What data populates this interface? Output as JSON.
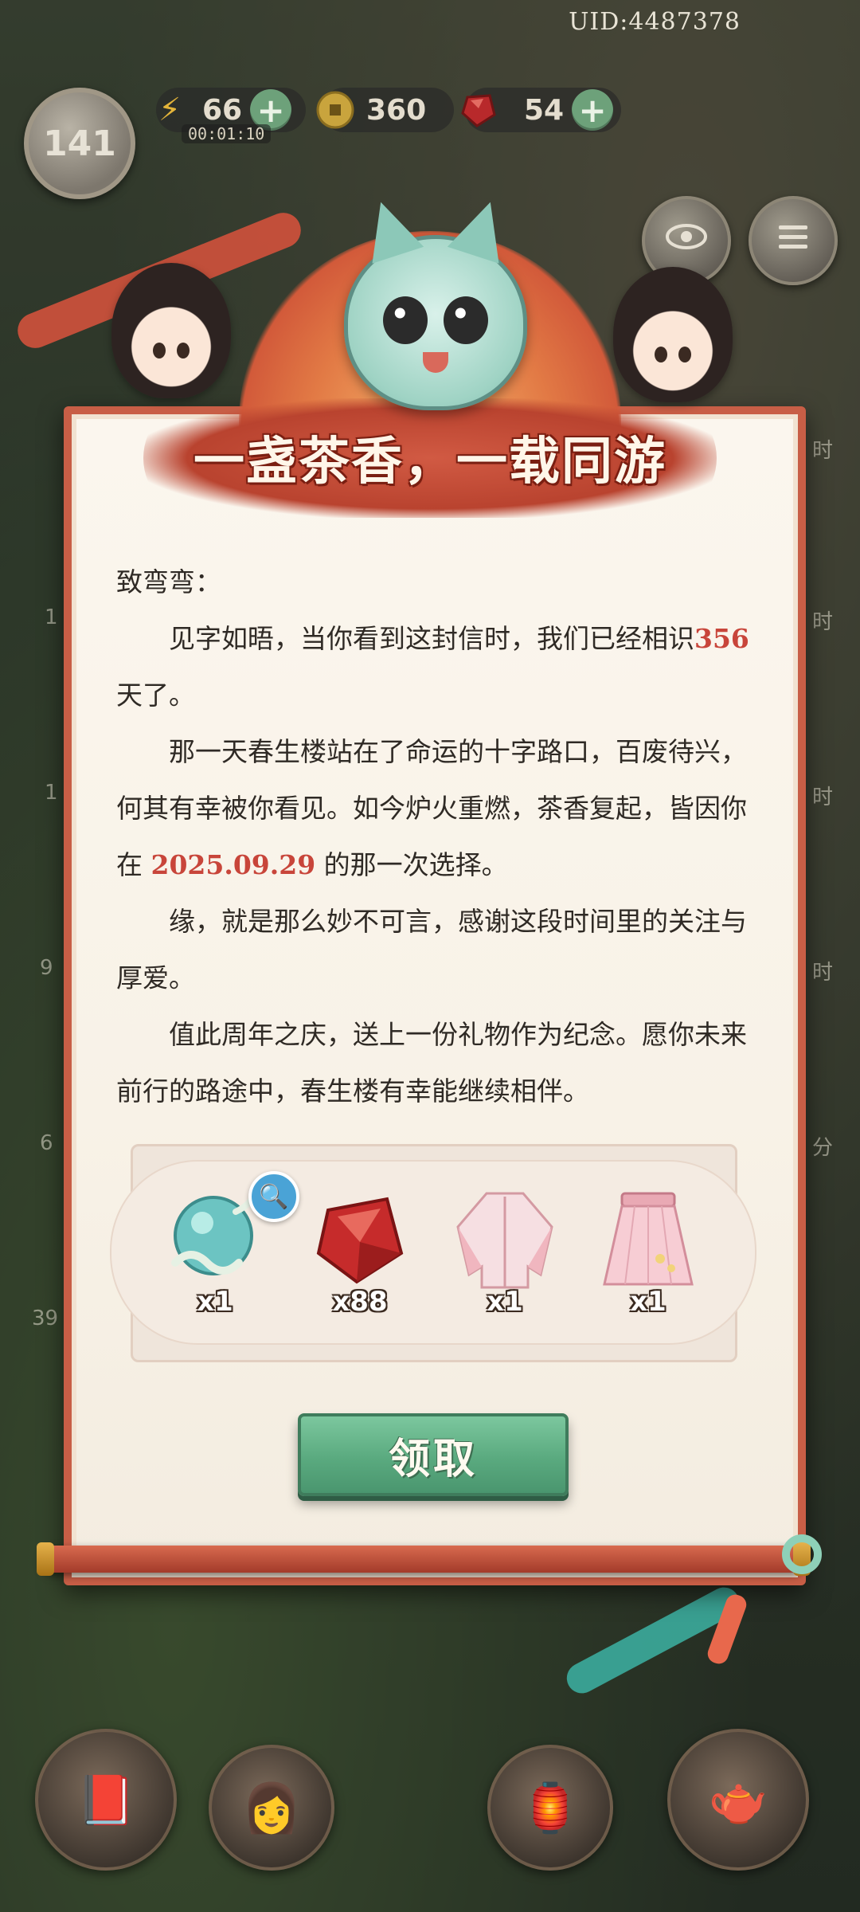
{
  "hud": {
    "uid": "UID:4487378",
    "level": "141",
    "energy": "66",
    "energy_timer": "00:01:10",
    "coins": "360",
    "gems": "54",
    "plus": "+"
  },
  "icons": {
    "energy": "lightning-icon",
    "coin": "coin-icon",
    "gem": "red-gem-icon",
    "eye": "eye-icon",
    "menu": "menu-icon"
  },
  "letter": {
    "title": "一盏茶香，一载同游",
    "salutation": "致弯弯：",
    "p1_before": "见字如晤，当你看到这封信时，我们已经相识",
    "days": "356",
    "p1_after": " 天了。",
    "p2_before": "那一天春生楼站在了命运的十字路口，百废待兴，何其有幸被你看见。如今炉火重燃，茶香复起，皆因你在 ",
    "date": "2025.09.29",
    "p2_after": " 的那一次选择。",
    "p3": "缘，就是那么妙不可言，感谢这段时间里的关注与厚爱。",
    "p4": "值此周年之庆，送上一份礼物作为纪念。愿你未来前行的路途中，春生楼有幸能继续相伴。"
  },
  "rewards": [
    {
      "name": "jade-cloud-orb",
      "qty": "x1"
    },
    {
      "name": "red-gem",
      "qty": "x88"
    },
    {
      "name": "pink-hanfu-top",
      "qty": "x1"
    },
    {
      "name": "pink-pleated-skirt",
      "qty": "x1"
    }
  ],
  "claim_label": "领取",
  "side_labels": [
    "时",
    "时",
    "时",
    "时",
    "分",
    "1",
    "1",
    "9",
    "6",
    "39"
  ],
  "colors": {
    "accent_red": "#c8453a",
    "button_green": "#5aaa7f",
    "scroll_border": "#c85e46"
  }
}
